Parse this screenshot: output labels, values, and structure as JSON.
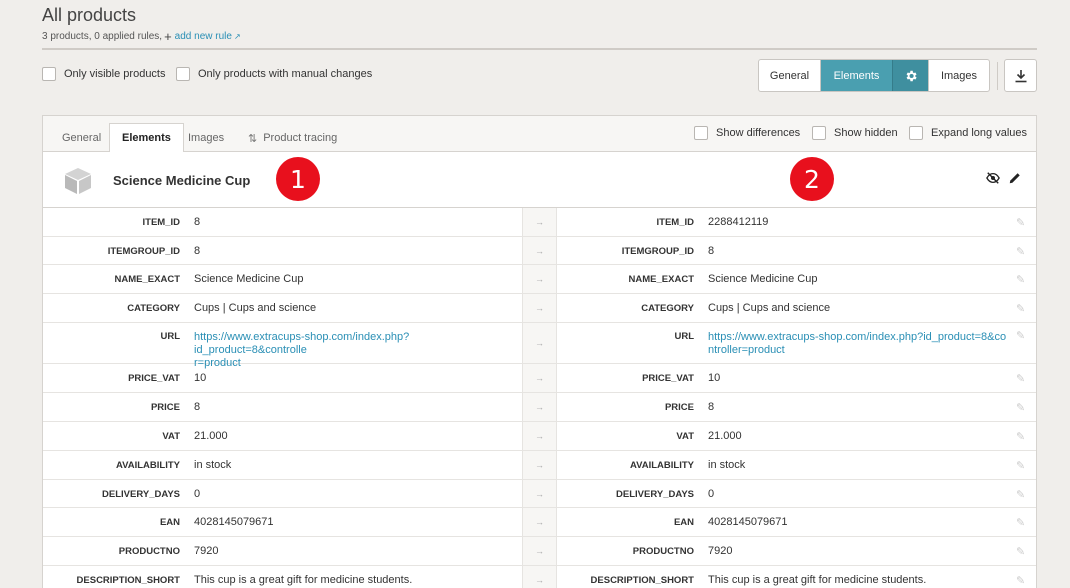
{
  "header": {
    "title": "All products",
    "summary": "3 products, 0 applied rules,",
    "add_rule": "add new rule"
  },
  "filters": {
    "only_visible": "Only visible products",
    "only_manual": "Only products with manual changes"
  },
  "view_toggle": {
    "general": "General",
    "elements": "Elements",
    "images": "Images",
    "active": "Elements"
  },
  "tabs": {
    "general": "General",
    "elements": "Elements",
    "images": "Images",
    "product_tracing": "Product tracing"
  },
  "options": {
    "show_differences": "Show differences",
    "show_hidden": "Show hidden",
    "expand_long_values": "Expand long values"
  },
  "product": {
    "name": "Science Medicine Cup",
    "marker_left": "1",
    "marker_right": "2"
  },
  "rows": [
    {
      "key": "ITEM_ID",
      "left": "8",
      "right": "2288412119"
    },
    {
      "key": "ITEMGROUP_ID",
      "left": "8",
      "right": "8"
    },
    {
      "key": "NAME_EXACT",
      "left": "Science Medicine Cup",
      "right": "Science Medicine Cup"
    },
    {
      "key": "CATEGORY",
      "left": "Cups | Cups and science",
      "right": "Cups | Cups and science"
    },
    {
      "key": "URL",
      "left_l1": "https://www.extracups-shop.com/index.php?id_product=8&controlle",
      "left_l2": "r=product",
      "right_l1": "https://www.extracups-shop.com/index.php?id_product=8&co",
      "right_l2": "ntroller=product"
    },
    {
      "key": "PRICE_VAT",
      "left": "10",
      "right": "10"
    },
    {
      "key": "PRICE",
      "left": "8",
      "right": "8"
    },
    {
      "key": "VAT",
      "left": "21.000",
      "right": "21.000"
    },
    {
      "key": "AVAILABILITY",
      "left": "in stock",
      "right": "in stock"
    },
    {
      "key": "DELIVERY_DAYS",
      "left": "0",
      "right": "0"
    },
    {
      "key": "EAN",
      "left": "4028145079671",
      "right": "4028145079671"
    },
    {
      "key": "PRODUCTNO",
      "left": "7920",
      "right": "7920"
    },
    {
      "key": "DESCRIPTION_SHORT",
      "left": "This cup is a great gift for medicine students.",
      "right": "This cup is a great gift for medicine students."
    }
  ],
  "colors": {
    "accent": "#4a9fb0",
    "link": "#2a8fb5",
    "marker": "#e8101d"
  }
}
